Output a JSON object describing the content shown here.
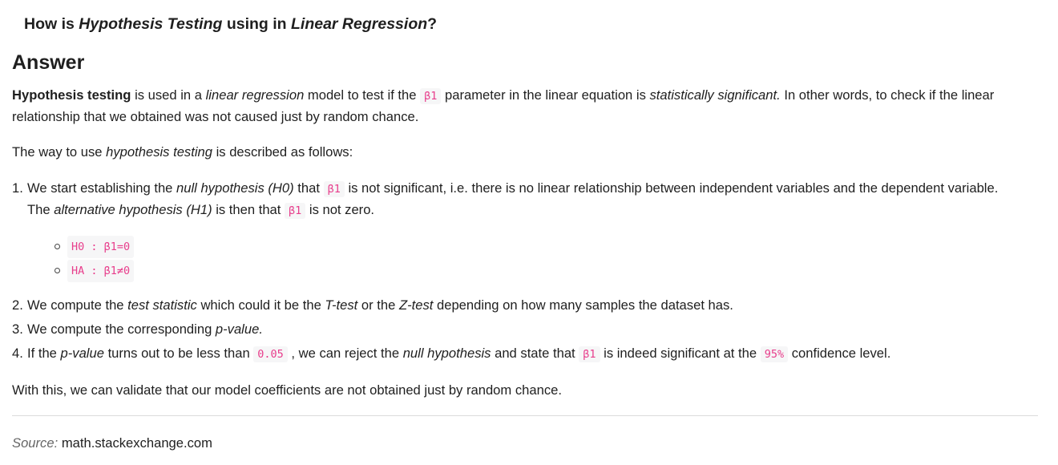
{
  "question": {
    "prefix": "How is ",
    "term1": "Hypothesis Testing",
    "middle": " using in ",
    "term2": "Linear Regression",
    "suffix": "?"
  },
  "answer_heading": "Answer",
  "para1": {
    "bold": "Hypothesis testing",
    "t1": " is used in a ",
    "em1": "linear regression",
    "t2": " model to test if the ",
    "code1": "β1",
    "t3": " parameter in the linear equation is ",
    "em2": "statistically significant.",
    "t4": " In other words, to check if the linear relationship that we obtained was not caused just by random chance."
  },
  "para2": {
    "t1": "The way to use ",
    "em1": "hypothesis testing",
    "t2": " is described as follows:"
  },
  "steps": [
    {
      "num": "1.",
      "t1": "We start establishing the ",
      "em1": "null hypothesis (H0)",
      "t2": " that ",
      "code1": "β1",
      "t3": " is not significant, i.e. there is no linear relationship between independent variables and the dependent variable. The ",
      "em2": "alternative hypothesis (H1)",
      "t4": " is then that ",
      "code2": "β1",
      "t5": " is not zero."
    },
    {
      "num": "2.",
      "t1": "We compute the ",
      "em1": "test statistic",
      "t2": " which could it be the ",
      "em2": "T-test",
      "t3": " or the ",
      "em3": "Z-test",
      "t4": " depending on how many samples the dataset has."
    },
    {
      "num": "3.",
      "t1": "We compute the corresponding ",
      "em1": "p-value.",
      "t2": ""
    },
    {
      "num": "4.",
      "t1": "If the ",
      "em1": "p-value",
      "t2": " turns out to be less than ",
      "code1": "0.05",
      "t3": " , we can reject the ",
      "em2": "null hypothesis",
      "t4": " and state that ",
      "code2": "β1",
      "t5": " is indeed significant at the ",
      "code3": "95%",
      "t6": " confidence level."
    }
  ],
  "sub_items": [
    "H0 : β1=0",
    "HA : β1≠0"
  ],
  "para3": "With this, we can validate that our model coefficients are not obtained just by random chance.",
  "source": {
    "label": "Source:",
    "value": "math.stackexchange.com"
  }
}
